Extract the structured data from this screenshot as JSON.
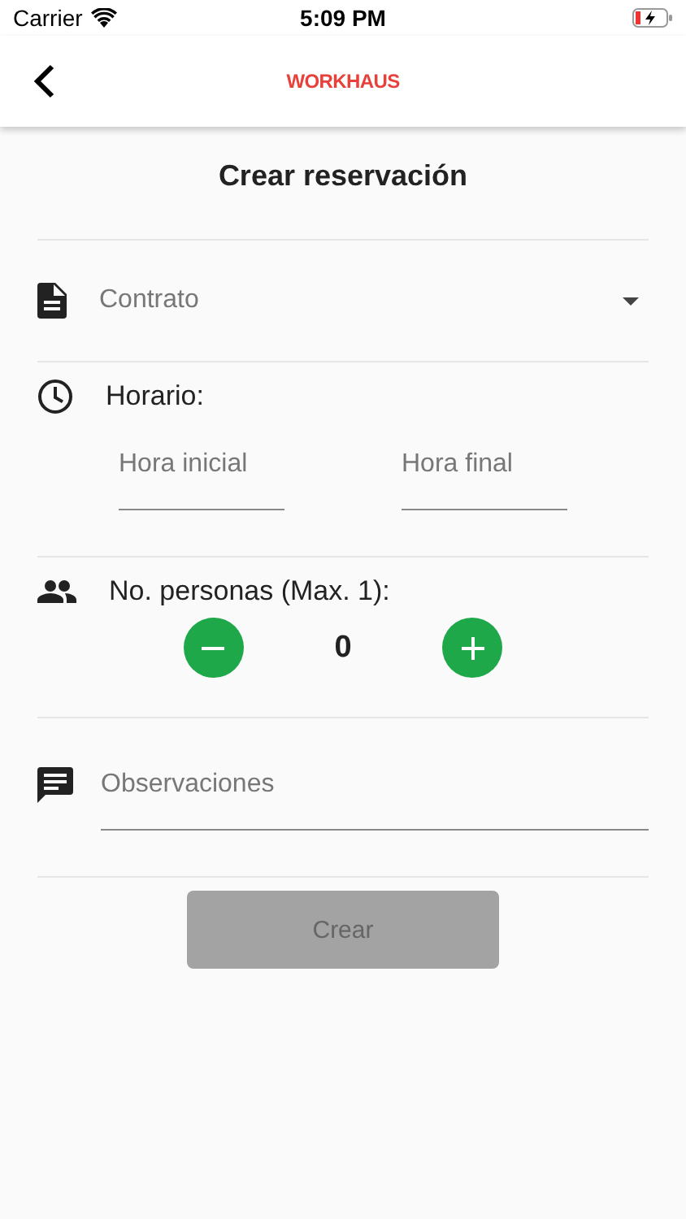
{
  "status_bar": {
    "carrier": "Carrier",
    "time": "5:09 PM"
  },
  "header": {
    "logo": "WORKHAUS"
  },
  "title": "Crear reservación",
  "contract": {
    "placeholder": "Contrato"
  },
  "schedule": {
    "label": "Horario:",
    "start": {
      "placeholder": "Hora inicial"
    },
    "end": {
      "placeholder": "Hora final"
    }
  },
  "people": {
    "label": "No. personas (Max. 1):",
    "count": "0"
  },
  "notes": {
    "placeholder": "Observaciones"
  },
  "submit": {
    "label": "Crear",
    "disabled": true
  }
}
